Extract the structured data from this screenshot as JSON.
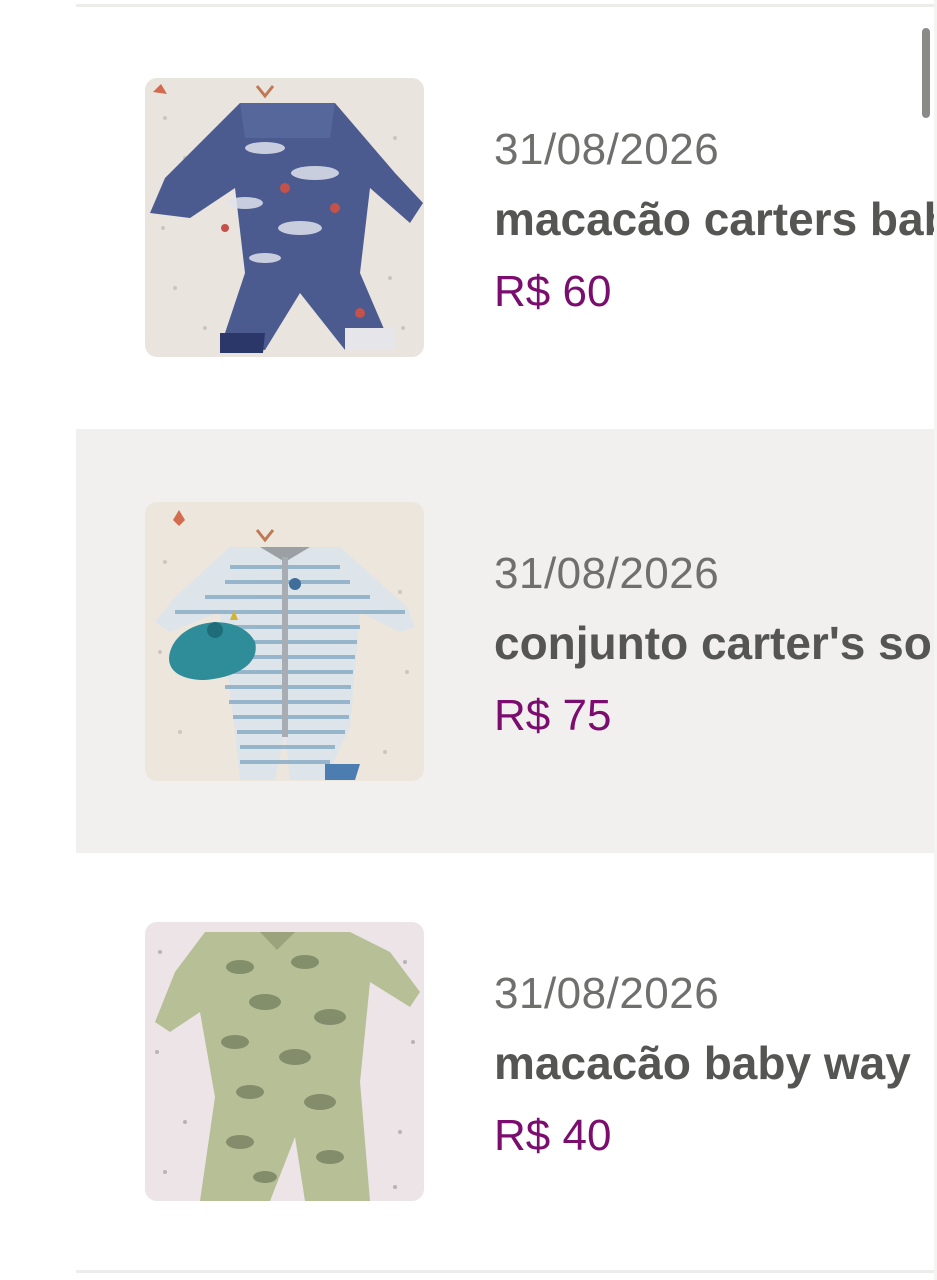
{
  "listings": [
    {
      "date": "31/08/2026",
      "title": "macacão carters baby",
      "price": "R$ 60",
      "image_icon": "blue-whale-romper-photo",
      "highlighted": false
    },
    {
      "date": "31/08/2026",
      "title": "conjunto carter's soninho",
      "price": "R$ 75",
      "image_icon": "striped-romper-with-hat-photo",
      "highlighted": true
    },
    {
      "date": "31/08/2026",
      "title": "macacão baby way",
      "price": "R$ 40",
      "image_icon": "green-car-print-romper-photo",
      "highlighted": false
    }
  ],
  "colors": {
    "price": "#7b0d6f",
    "title": "#555553",
    "date": "#6f6f6d",
    "highlight_bg": "#f1f0ee"
  }
}
